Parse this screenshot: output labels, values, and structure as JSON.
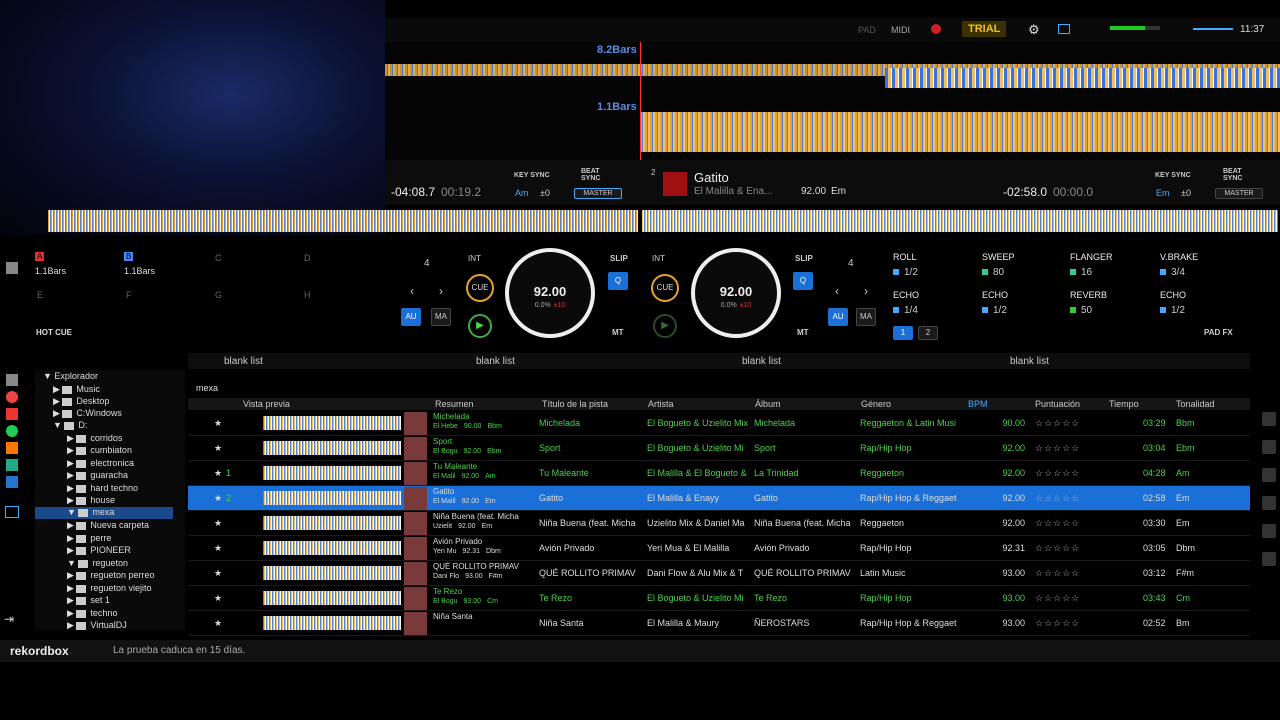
{
  "topbar": {
    "pad": "PAD",
    "midi": "MIDI",
    "trial": "TRIAL",
    "clock": "11:37"
  },
  "deck1": {
    "time_remaining": "-04:08.7",
    "time_elapsed": "00:19.2",
    "key_sync": "KEY SYNC",
    "key": "Am",
    "key_offset": "±0",
    "beat_sync": "BEAT SYNC",
    "master": "MASTER",
    "bars_top": "8.2Bars",
    "bars_bottom": "1.1Bars"
  },
  "deck2": {
    "number": "2",
    "title": "Gatito",
    "artist": "El Malilla & Ena...",
    "bpm": "92.00",
    "key": "Em",
    "time_remaining": "-02:58.0",
    "time_elapsed": "00:00.0",
    "key_sync": "KEY SYNC",
    "key_offset": "±0",
    "beat_sync": "BEAT SYNC",
    "master": "MASTER"
  },
  "hotcue": {
    "pads": [
      {
        "letter": "A",
        "label": "1.1Bars"
      },
      {
        "letter": "B",
        "label": "1.1Bars"
      },
      {
        "letter": "C",
        "label": ""
      },
      {
        "letter": "D",
        "label": ""
      },
      {
        "letter": "E",
        "label": ""
      },
      {
        "letter": "F",
        "label": ""
      },
      {
        "letter": "G",
        "label": ""
      },
      {
        "letter": "H",
        "label": ""
      }
    ],
    "mode": "HOT CUE"
  },
  "left_controls": {
    "beat": "4",
    "int": "INT",
    "cue": "CUE",
    "au": "AU",
    "ma": "MA",
    "slip": "SLIP",
    "q": "Q",
    "mt": "MT",
    "bpm": "92.00",
    "pitch": "0.0%",
    "range": "±10"
  },
  "right_controls": {
    "beat": "4",
    "int": "INT",
    "cue": "CUE",
    "au": "AU",
    "ma": "MA",
    "slip": "SLIP",
    "q": "Q",
    "mt": "MT",
    "bpm": "92.00",
    "pitch": "0.0%",
    "range": "±10"
  },
  "fx": {
    "cells": [
      {
        "name": "ROLL",
        "value": "1/2"
      },
      {
        "name": "SWEEP",
        "value": "80"
      },
      {
        "name": "FLANGER",
        "value": "16"
      },
      {
        "name": "V.BRAKE",
        "value": "3/4"
      },
      {
        "name": "ECHO",
        "value": "1/4"
      },
      {
        "name": "ECHO",
        "value": "1/2"
      },
      {
        "name": "REVERB",
        "value": "50"
      },
      {
        "name": "ECHO",
        "value": "1/2"
      }
    ],
    "bank1": "1",
    "bank2": "2",
    "padfx": "PAD FX"
  },
  "playlists": {
    "p1": "blank list",
    "p2": "blank list",
    "p3": "blank list",
    "p4": "blank list"
  },
  "browser": {
    "current": "mexa",
    "columns": [
      "Vista previa",
      "Resumen",
      "Título de la pista",
      "Artista",
      "Álbum",
      "Género",
      "BPM",
      "Puntuación",
      "Tiempo",
      "Tonalidad"
    ]
  },
  "tree": {
    "root": "Explorador",
    "items": [
      "Music",
      "Desktop",
      "C:Windows",
      "D:",
      "corridos",
      "cumbiaton",
      "electronica",
      "guaracha",
      "hard techno",
      "house",
      "mexa",
      "Nueva carpeta",
      "perre",
      "PIONEER",
      "regueton",
      "regueton perreo",
      "regueton viejito",
      "set 1",
      "techno",
      "VirtualDJ"
    ]
  },
  "tracks": [
    {
      "tag": "",
      "summary_title": "Michelada",
      "summary_artist": "El Hebe",
      "summary_bpm": "90.00",
      "summary_key": "Bbm",
      "title": "Michelada",
      "artist": "El Bogueto & Uzielito Mix",
      "album": "Michelada",
      "genre": "Reggaeton & Latin Musi",
      "bpm": "90.00",
      "time": "03:29",
      "key": "Bbm",
      "green": true
    },
    {
      "tag": "",
      "summary_title": "Sport",
      "summary_artist": "El Bogu",
      "summary_bpm": "92.00",
      "summary_key": "Ebm",
      "title": "Sport",
      "artist": "El Bogueto & Uzielito Mi",
      "album": "Sport",
      "genre": "Rap/Hip Hop",
      "bpm": "92.00",
      "time": "03:04",
      "key": "Ebm",
      "green": true
    },
    {
      "tag": "1",
      "summary_title": "Tu Maleante",
      "summary_artist": "El Malil",
      "summary_bpm": "92.00",
      "summary_key": "Am",
      "title": "Tu Maleante",
      "artist": "El Malilla & El Bogueto &",
      "album": "La Trinidad",
      "genre": "Reggaeton",
      "bpm": "92.00",
      "time": "04:28",
      "key": "Am",
      "green": true
    },
    {
      "tag": "2",
      "summary_title": "Gatito",
      "summary_artist": "El Malil",
      "summary_bpm": "92.00",
      "summary_key": "Em",
      "title": "Gatito",
      "artist": "El Malilla & Enayy",
      "album": "Gatito",
      "genre": "Rap/Hip Hop & Reggaet",
      "bpm": "92.00",
      "time": "02:58",
      "key": "Em",
      "green": true
    },
    {
      "tag": "",
      "summary_title": "Niña Buena (feat. Micha",
      "summary_artist": "Uzielit",
      "summary_bpm": "92.00",
      "summary_key": "Em",
      "title": "Niña Buena (feat. Micha",
      "artist": "Uzielito Mix & Daniel Ma",
      "album": "Niña Buena (feat. Micha",
      "genre": "Reggaeton",
      "bpm": "92.00",
      "time": "03:30",
      "key": "Em",
      "green": false
    },
    {
      "tag": "",
      "summary_title": "Avión Privado",
      "summary_artist": "Yeri Mu",
      "summary_bpm": "92.31",
      "summary_key": "Dbm",
      "title": "Avión Privado",
      "artist": "Yeri Mua & El Malilla",
      "album": "Avión Privado",
      "genre": "Rap/Hip Hop",
      "bpm": "92.31",
      "time": "03:05",
      "key": "Dbm",
      "green": false
    },
    {
      "tag": "",
      "summary_title": "QUÉ ROLLITO PRIMAV",
      "summary_artist": "Dani Flo",
      "summary_bpm": "93.00",
      "summary_key": "F#m",
      "title": "QUÉ ROLLITO PRIMAV",
      "artist": "Dani Flow & Alu Mix & T",
      "album": "QUÉ ROLLITO PRIMAV",
      "genre": "Latin Music",
      "bpm": "93.00",
      "time": "03:12",
      "key": "F#m",
      "green": false
    },
    {
      "tag": "",
      "summary_title": "Te Rezo",
      "summary_artist": "El Bogu",
      "summary_bpm": "93.00",
      "summary_key": "Cm",
      "title": "Te Rezo",
      "artist": "El Bogueto & Uzielito Mi",
      "album": "Te Rezo",
      "genre": "Rap/Hip Hop",
      "bpm": "93.00",
      "time": "03:43",
      "key": "Cm",
      "green": true
    },
    {
      "tag": "",
      "summary_title": "Niña Santa",
      "summary_artist": "",
      "summary_bpm": "",
      "summary_key": "",
      "title": "Niña Santa",
      "artist": "El Malilla & Maury",
      "album": "ÑEROSTARS",
      "genre": "Rap/Hip Hop & Reggaet",
      "bpm": "93.00",
      "time": "02:52",
      "key": "Bm",
      "green": false
    }
  ],
  "footer": {
    "brand": "rekordbox",
    "trial_notice": "La prueba caduca en 15 días."
  }
}
